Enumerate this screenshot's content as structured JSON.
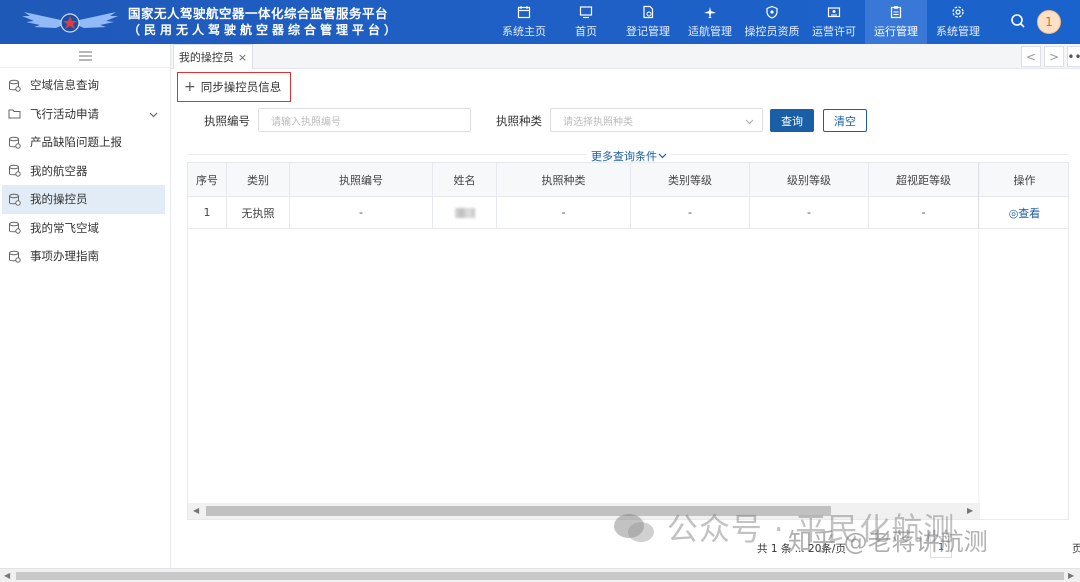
{
  "header": {
    "title": "国家无人驾驶航空器一体化综合监管服务平台",
    "subtitle": "（民用无人驾驶航空器综合管理平台）",
    "nav": [
      {
        "label": "系统主页",
        "icon": "calendar-icon"
      },
      {
        "label": "首页",
        "icon": "monitor-icon"
      },
      {
        "label": "登记管理",
        "icon": "document-icon"
      },
      {
        "label": "适航管理",
        "icon": "plane-icon"
      },
      {
        "label": "操控员资质",
        "icon": "shield-icon"
      },
      {
        "label": "运营许可",
        "icon": "id-card-icon"
      },
      {
        "label": "运行管理",
        "icon": "clipboard-icon",
        "active": true
      },
      {
        "label": "系统管理",
        "icon": "settings-icon"
      }
    ],
    "avatar_text": "1"
  },
  "sidebar": {
    "items": [
      {
        "label": "空域信息查询"
      },
      {
        "label": "飞行活动申请",
        "expandable": true
      },
      {
        "label": "产品缺陷问题上报"
      },
      {
        "label": "我的航空器"
      },
      {
        "label": "我的操控员",
        "active": true
      },
      {
        "label": "我的常飞空域"
      },
      {
        "label": "事项办理指南"
      }
    ]
  },
  "tabs": [
    {
      "label": "我的操控员",
      "close": "×"
    }
  ],
  "tab_nav": {
    "prev": "<",
    "next": ">",
    "more": "••"
  },
  "toolbar": {
    "sync_label": "同步操控员信息",
    "plus": "+"
  },
  "search": {
    "license_no_label": "执照编号",
    "license_no_placeholder": "请输入执照编号",
    "license_type_label": "执照种类",
    "license_type_placeholder": "请选择执照种类",
    "query_label": "查询",
    "clear_label": "清空",
    "more_label": "更多查询条件"
  },
  "table": {
    "columns": [
      "序号",
      "类别",
      "执照编号",
      "姓名",
      "执照种类",
      "类别等级",
      "级别等级",
      "超视距等级",
      "操作"
    ],
    "rows": [
      {
        "index": "1",
        "category": "无执照",
        "license_no": "-",
        "name": "",
        "license_type": "-",
        "category_level": "-",
        "grade_level": "-",
        "bvlos_level": "-",
        "action": "◎查看"
      }
    ]
  },
  "pagination": {
    "summary": "共 1 条 ... 20条/页",
    "current": "1",
    "last_text": "页"
  },
  "watermark": {
    "line1": "公众号 · 平民化航测",
    "line2": "知乎 @老蒋讲航测"
  }
}
